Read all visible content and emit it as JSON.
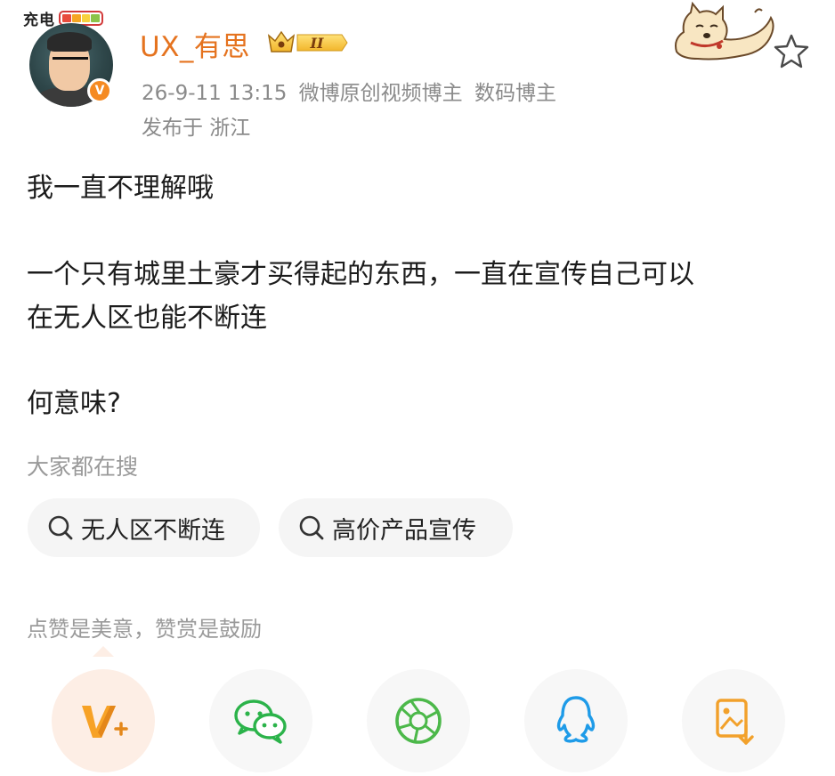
{
  "status": {
    "charge_label": "充电",
    "battery_colors": [
      "#e84c3d",
      "#f5a623",
      "#f7d23e",
      "#8bc34a"
    ]
  },
  "author": {
    "name": "UX_有思",
    "level_badge": "II",
    "timestamp": "26-9-11 13:15",
    "tags": [
      "微博原创视频博主",
      "数码博主"
    ],
    "location": "发布于 浙江",
    "name_color": "#e5731f"
  },
  "post": {
    "paragraphs": [
      "我一直不理解哦",
      "一个只有城里土豪才买得起的东西，一直在宣传自己可以",
      "在无人区也能不断连",
      "何意味?"
    ]
  },
  "trending": {
    "title": "大家都在搜",
    "items": [
      "无人区不断连",
      "高价产品宣传"
    ]
  },
  "reward": {
    "text": "点赞是美意，赞赏是鼓励"
  },
  "share": {
    "buttons": [
      "reward-v-icon",
      "wechat-icon",
      "moments-icon",
      "qq-icon",
      "save-image-icon"
    ],
    "accent": "#f58a21"
  }
}
